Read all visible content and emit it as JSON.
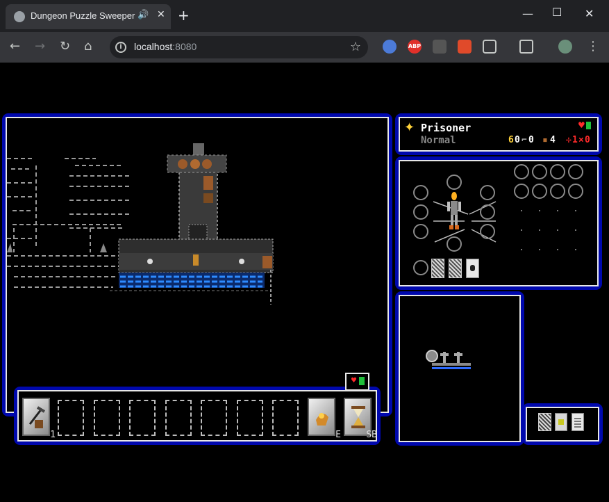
{
  "browser": {
    "tab_title": "Dungeon Puzzle Sweeper",
    "url_host": "localhost",
    "url_port": ":8080",
    "new_tab_label": "+",
    "extensions": [
      "ABP"
    ]
  },
  "player": {
    "name": "Prisoner",
    "mode": "Normal",
    "stats": {
      "gold": "0",
      "keys": "0",
      "food": "4",
      "hp": "1",
      "xp": "0"
    }
  },
  "toolbar": {
    "first_key": "1",
    "e_key": "E",
    "sb_key": "SB",
    "empty_slot_count": 7
  },
  "colors": {
    "panel_border": "#0008ad",
    "health": "#ff2a2a",
    "gold": "#ffd23a",
    "water": "#2e8bff"
  }
}
